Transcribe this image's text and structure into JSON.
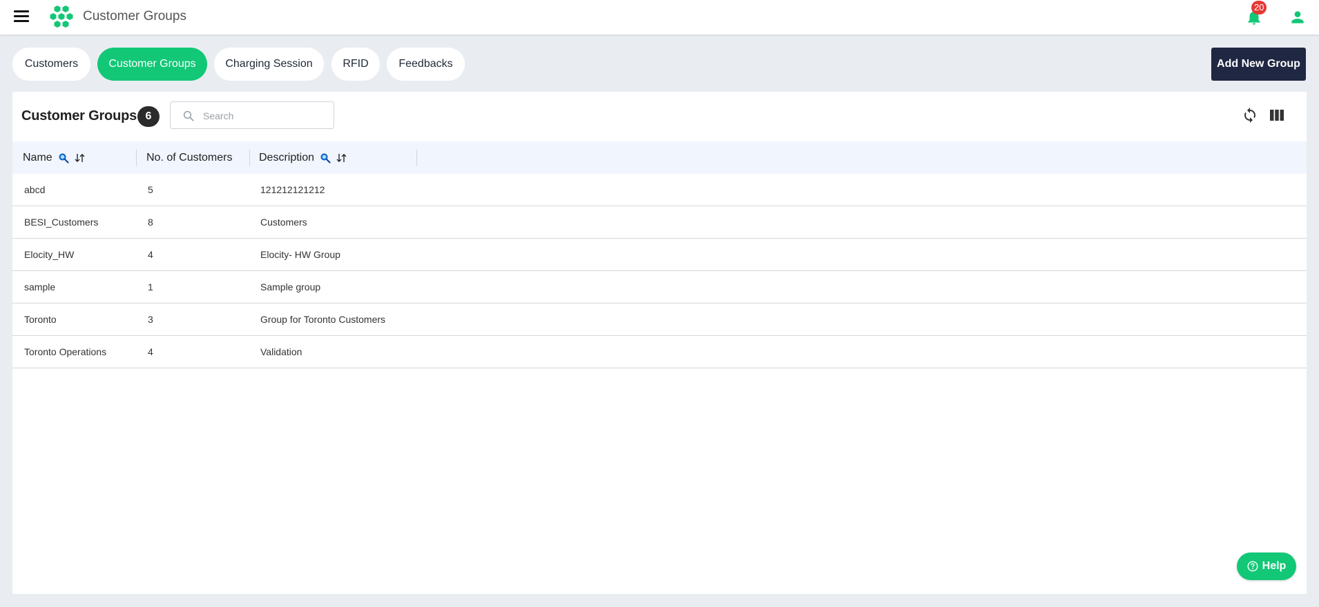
{
  "header": {
    "title": "Customer Groups",
    "notification_count": "20",
    "icons": [
      "menu-icon",
      "hexagon-logo",
      "bell-icon",
      "user-icon"
    ]
  },
  "tabs": [
    {
      "label": "Customers",
      "active": false
    },
    {
      "label": "Customer Groups",
      "active": true
    },
    {
      "label": "Charging Session",
      "active": false
    },
    {
      "label": "RFID",
      "active": false
    },
    {
      "label": "Feedbacks",
      "active": false
    }
  ],
  "add_button": "Add New Group",
  "panel": {
    "title": "Customer Groups",
    "count": "6",
    "search_placeholder": "Search"
  },
  "table": {
    "columns": [
      "Name",
      "No. of Customers",
      "Description"
    ],
    "rows": [
      {
        "name": "abcd",
        "count": "5",
        "description": "121212121212"
      },
      {
        "name": "BESI_Customers",
        "count": "8",
        "description": "Customers"
      },
      {
        "name": "Elocity_HW",
        "count": "4",
        "description": "Elocity- HW Group"
      },
      {
        "name": "sample",
        "count": "1",
        "description": "Sample group"
      },
      {
        "name": "Toronto",
        "count": "3",
        "description": "Group for Toronto Customers"
      },
      {
        "name": "Toronto Operations",
        "count": "4",
        "description": "Validation"
      }
    ]
  },
  "help_button": "Help",
  "colors": {
    "accent": "#12c776",
    "dark_button": "#1f2742",
    "badge": "#e53935",
    "header_row": "#f1f5fd",
    "page_bg": "#e9edf2"
  }
}
